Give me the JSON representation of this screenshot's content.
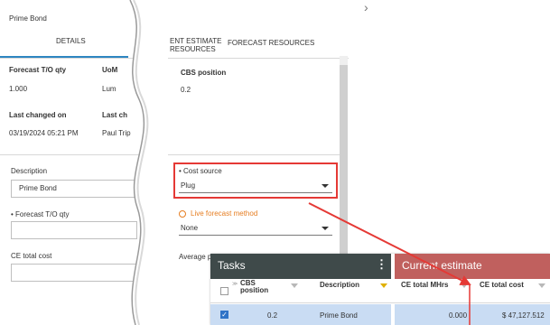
{
  "left_panel": {
    "title": "Prime Bond",
    "tab_details": "DETAILS",
    "fields": {
      "forecast_qty_label": "Forecast T/O qty",
      "forecast_qty_value": "1.000",
      "uom_label": "UoM",
      "uom_value": "Lum",
      "last_changed_on_label": "Last changed on",
      "last_changed_on_value": "03/19/2024 05:21 PM",
      "last_changed_by_label": "Last ch",
      "last_changed_by_value": "Paul Trip"
    },
    "description_label": "Description",
    "description_value": "Prime Bond",
    "forecast_qty_input_label": "• Forecast T/O qty",
    "forecast_qty_input_value": "",
    "ce_total_cost_label": "CE total cost",
    "ce_total_cost_value": ""
  },
  "right_panel": {
    "tab_estimate_line1": "ENT ESTIMATE",
    "tab_estimate_line2": "RESOURCES",
    "tab_forecast": "FORECAST RESOURCES",
    "cbs_label": "CBS position",
    "cbs_value": "0.2",
    "cost_source_label": "• Cost source",
    "cost_source_value": "Plug",
    "live_forecast_label": "Live forecast method",
    "live_forecast_value": "None",
    "average_label": "Average p",
    "chevron": "›"
  },
  "popup": {
    "tasks_header": "Tasks",
    "menu_glyph": "⋮",
    "ce_header": "Current estimate",
    "columns": {
      "cbs_line1": "CBS",
      "cbs_line2": "position",
      "description": "Description",
      "ce_total_mhrs": "CE total MHrs",
      "ce_total_cost": "CE total cost"
    },
    "row": {
      "cbs": "0.2",
      "description": "Prime Bond",
      "ce_total_mhrs": "0.000",
      "ce_total_cost": "$ 47,127.512"
    }
  },
  "colors": {
    "accent_blue": "#2e86c1",
    "highlight_red": "#e53935",
    "tasks_header_bg": "#3f4a4a",
    "ce_header_bg": "#c0605e",
    "selected_row": "#c9dcf3",
    "live_forecast_orange": "#e67e22"
  }
}
